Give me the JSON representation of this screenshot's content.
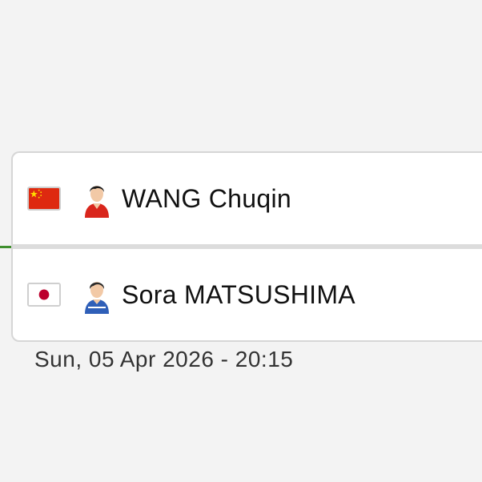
{
  "match": {
    "players": [
      {
        "name": "WANG Chuqin",
        "flag_icon": "china-flag-icon",
        "avatar_icon": "player-avatar-icon"
      },
      {
        "name": "Sora MATSUSHIMA",
        "flag_icon": "japan-flag-icon",
        "avatar_icon": "player-avatar-icon"
      }
    ],
    "datetime": "Sun, 05 Apr 2026 - 20:15"
  },
  "colors": {
    "background": "#f3f3f3",
    "card": "#ffffff",
    "card_border": "#d6d6d6",
    "connector": "#3f8f2e",
    "china_red": "#de2910",
    "china_star": "#ffde00",
    "japan_red": "#bc002d"
  }
}
